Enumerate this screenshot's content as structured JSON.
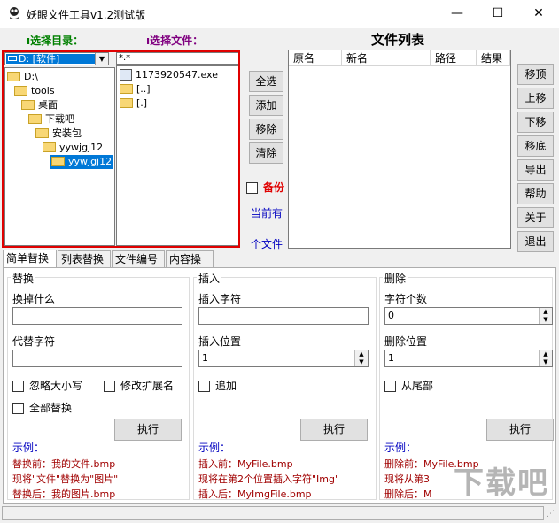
{
  "window": {
    "title": "妖眼文件工具v1.2测试版",
    "min_glyph": "—",
    "max_glyph": "☐",
    "close_glyph": "✕"
  },
  "labels": {
    "select_dir": "选择目录：",
    "select_file": "选择文件：",
    "file_list": "文件列表",
    "backup": "备份",
    "current": "当前有",
    "count_suffix": "个文件"
  },
  "drive": "D: [软件]",
  "tree": [
    {
      "label": "D:\\",
      "indent": 0
    },
    {
      "label": "tools",
      "indent": 1
    },
    {
      "label": "桌面",
      "indent": 2
    },
    {
      "label": "下载吧",
      "indent": 3
    },
    {
      "label": "安装包",
      "indent": 4
    },
    {
      "label": "yywjgj12",
      "indent": 5
    },
    {
      "label": "yywjgj12",
      "indent": 6,
      "selected": true
    }
  ],
  "filter": "*.*",
  "files": [
    {
      "name": "1173920547.exe",
      "type": "exe"
    },
    {
      "name": "[..]",
      "type": "folder"
    },
    {
      "name": "[.]",
      "type": "folder"
    }
  ],
  "mid_buttons": [
    "全选",
    "添加",
    "移除",
    "清除"
  ],
  "columns": [
    "原名",
    "新名",
    "路径",
    "结果"
  ],
  "right_buttons": [
    "移顶",
    "上移",
    "下移",
    "移底",
    "导出",
    "帮助",
    "关于",
    "退出"
  ],
  "tabs": [
    "简单替换",
    "列表替换",
    "文件编号",
    "内容操作"
  ],
  "replace": {
    "title": "替换",
    "find_label": "换掉什么",
    "find_value": "",
    "with_label": "代替字符",
    "with_value": "",
    "ignore_case": "忽略大小写",
    "modify_ext": "修改扩展名",
    "replace_all": "全部替换",
    "exec": "执行",
    "example": "示例：",
    "ex1": "替换前：我的文件.bmp",
    "ex2": "现将\"文件\"替换为\"图片\"",
    "ex3": "替换后：我的图片.bmp"
  },
  "insert": {
    "title": "插入",
    "chars_label": "插入字符",
    "chars_value": "",
    "pos_label": "插入位置",
    "pos_value": "1",
    "append": "追加",
    "exec": "执行",
    "example": "示例：",
    "ex1": "插入前：MyFile.bmp",
    "ex2": "现将在第2个位置插入字符\"Img\"",
    "ex3": "插入后：MyImgFile.bmp"
  },
  "delete": {
    "title": "删除",
    "count_label": "字符个数",
    "count_value": "0",
    "pos_label": "删除位置",
    "pos_value": "1",
    "from_end": "从尾部",
    "exec": "执行",
    "example": "示例：",
    "ex1": "删除前：MyFile.bmp",
    "ex2": "现将从第3",
    "ex3": "删除后：M"
  },
  "watermark": "下载吧"
}
